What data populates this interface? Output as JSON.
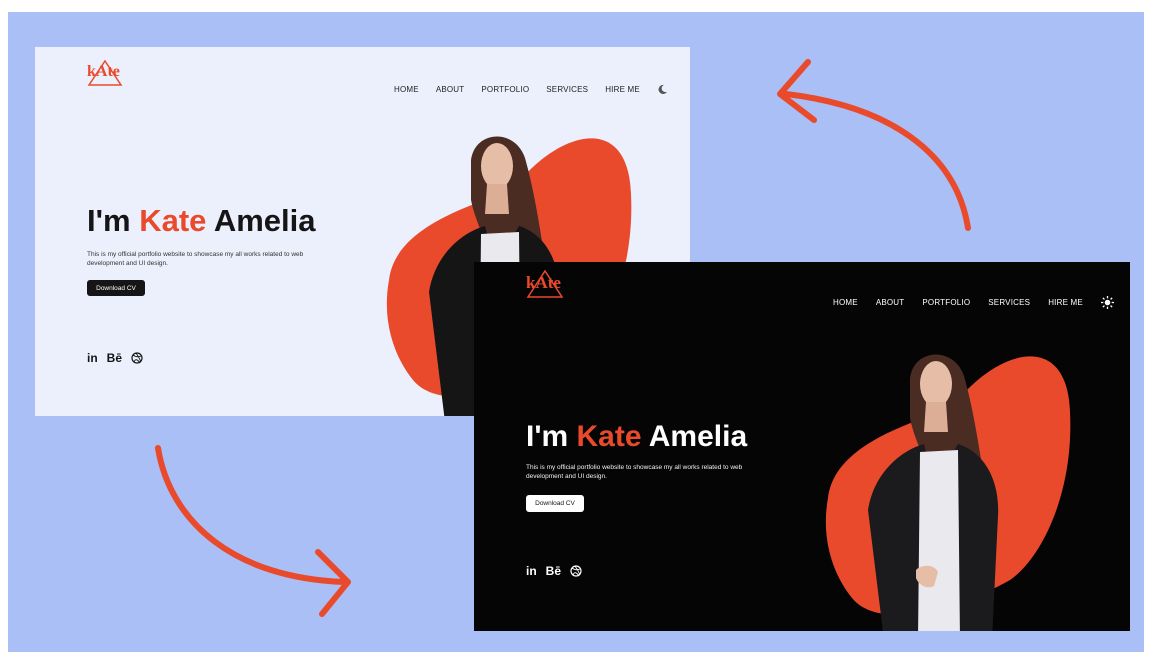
{
  "logo": {
    "text": "kAte"
  },
  "nav": {
    "home": "HOME",
    "about": "ABOUT",
    "portfolio": "PORTFOLIO",
    "services": "SERVICES",
    "hire": "HIRE ME"
  },
  "hero": {
    "intro": "I'm",
    "first_name": "Kate",
    "last_name": "Amelia",
    "description": "This is my official portfolio website to showcase my all works related to web development and UI design.",
    "cta": "Download CV"
  },
  "social": {
    "linkedin": "in",
    "behance": "Bē"
  },
  "light_theme": {
    "theme_toggle_icon": "moon-icon"
  },
  "dark_theme": {
    "theme_toggle_icon": "sun-icon"
  },
  "colors": {
    "accent": "#ea4a2c",
    "background": "#a9bff5",
    "light_page": "#ecf0fd",
    "dark_page": "#050506"
  }
}
